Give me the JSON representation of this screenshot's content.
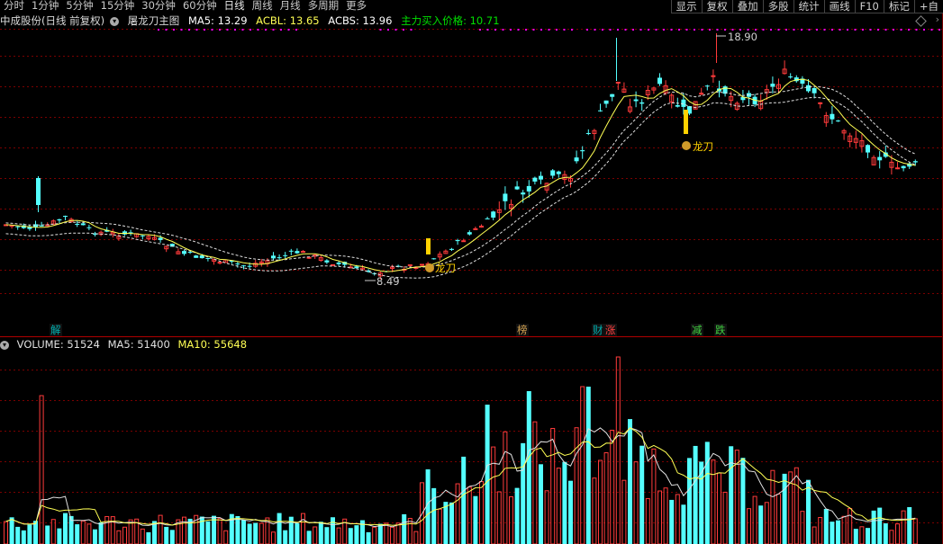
{
  "toolbar": {
    "periods": [
      "分时",
      "1分钟",
      "5分钟",
      "15分钟",
      "30分钟",
      "60分钟",
      "日线",
      "周线",
      "月线",
      "多周期",
      "更多"
    ],
    "active_index": 6,
    "right_buttons": [
      "显示",
      "复权",
      "叠加",
      "多股",
      "统计",
      "画线",
      "F10",
      "标记",
      "+自"
    ]
  },
  "main_info": {
    "stock": "中成股份(日线 前复权)",
    "indicator": "屠龙刀主图",
    "ma5": "MA5: 13.29",
    "acbl": "ACBL: 13.65",
    "acbs": "ACBS: 13.96",
    "main_buy": "主力买入价格: 10.71"
  },
  "volume_info": {
    "volume": "VOLUME: 51524",
    "ma5": "MA5: 51400",
    "ma10": "MA10: 55648"
  },
  "annotations": {
    "high_label": "18.90",
    "low_label": "8.49",
    "signal_1": "龙刀",
    "signal_2": "龙刀"
  },
  "news_tags": [
    {
      "text": "解",
      "color": "#00b0b0"
    },
    {
      "text": "榜",
      "color": "#d0a050"
    },
    {
      "text": "财",
      "color": "#00b0b0"
    },
    {
      "text": "涨",
      "color": "#ff4040"
    },
    {
      "text": "减",
      "color": "#40d040"
    },
    {
      "text": "跌",
      "color": "#40d040"
    }
  ],
  "colors": {
    "up": "#ff3b3b",
    "down": "#54ffff",
    "ma5": "#ffff54",
    "acb": "#e0e0e0",
    "grid": "#7a0000",
    "main_buy": "#00e000",
    "magenta": "#ff00ff"
  }
}
